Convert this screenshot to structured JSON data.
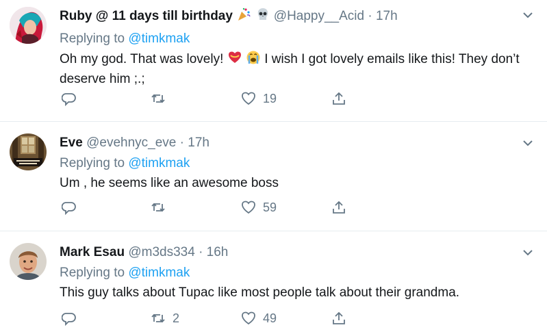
{
  "replies": [
    {
      "name": "Ruby @ 11 days till birthday",
      "handle": "@Happy__Acid",
      "time": "17h",
      "replying_prefix": "Replying to",
      "replying_to": "@timkmak",
      "text_before_emoji": "Oh my god. That was lovely!",
      "text_after_emoji": "I wish I got lovely emails like this! They don’t deserve him ;.;",
      "retweets": "",
      "likes": "19"
    },
    {
      "name": "Eve",
      "handle": "@evehnyc_eve",
      "time": "17h",
      "replying_prefix": "Replying to",
      "replying_to": "@timkmak",
      "text": "Um , he seems like an awesome boss",
      "retweets": "",
      "likes": "59"
    },
    {
      "name": "Mark Esau",
      "handle": "@m3ds334",
      "time": "16h",
      "replying_prefix": "Replying to",
      "replying_to": "@timkmak",
      "text": "This guy talks about Tupac like most people talk about their grandma.",
      "retweets": "2",
      "likes": "49"
    }
  ],
  "icons": {
    "reply": "reply-icon",
    "retweet": "retweet-icon",
    "like": "heart-icon",
    "share": "share-icon",
    "more": "chevron-down-icon"
  },
  "colors": {
    "link": "#1da1f2",
    "muted": "#657786",
    "text": "#14171a",
    "divider": "#e6ecf0"
  }
}
